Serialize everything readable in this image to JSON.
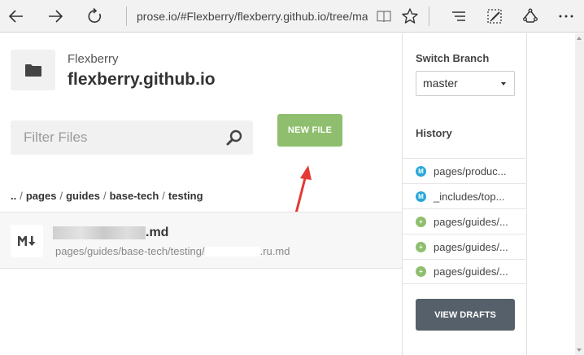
{
  "browser": {
    "url": "prose.io/#Flexberry/flexberry.github.io/tree/mas",
    "icons": [
      "back-icon",
      "forward-icon",
      "refresh-icon",
      "reading-view-icon",
      "favorite-star-icon",
      "hub-icon",
      "web-note-icon",
      "share-icon",
      "more-icon"
    ]
  },
  "repo": {
    "owner": "Flexberry",
    "name": "flexberry.github.io"
  },
  "filter": {
    "placeholder": "Filter Files"
  },
  "actions": {
    "new_file": "NEW FILE",
    "view_drafts": "VIEW DRAFTS"
  },
  "breadcrumb": {
    "up": "..",
    "separator": "/",
    "parts": [
      "pages",
      "guides",
      "base-tech",
      "testing"
    ]
  },
  "file": {
    "name_suffix": ".md",
    "path_prefix": "pages/guides/base-tech/testing/",
    "path_suffix": ".ru.md"
  },
  "sidebar": {
    "switch_branch_title": "Switch Branch",
    "branch": "master",
    "history_title": "History",
    "history": [
      {
        "label": "pages/produc...",
        "type": "modified"
      },
      {
        "label": "_includes/top...",
        "type": "modified"
      },
      {
        "label": "pages/guides/...",
        "type": "added"
      },
      {
        "label": "pages/guides/...",
        "type": "added"
      },
      {
        "label": "pages/guides/...",
        "type": "added"
      }
    ]
  },
  "colors": {
    "new_file_bg": "#8fbf6e",
    "view_drafts_bg": "#56606a",
    "modified_icon": "#29a8d8",
    "added_icon": "#8fbf6e",
    "annotation_arrow": "#e53935"
  }
}
